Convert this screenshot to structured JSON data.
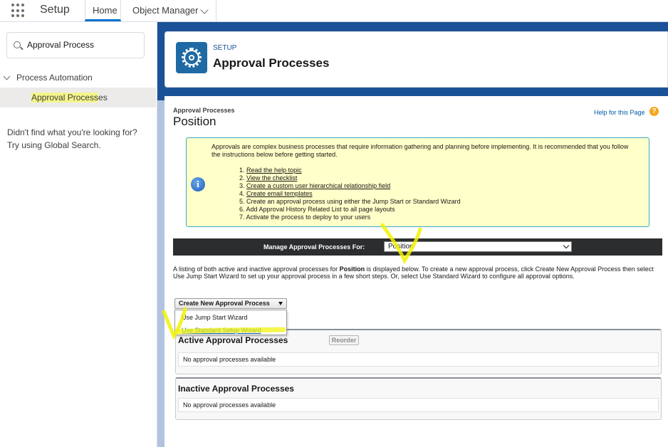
{
  "topbar": {
    "app_name": "Setup",
    "tabs": [
      {
        "label": "Home"
      },
      {
        "label": "Object Manager"
      }
    ]
  },
  "sidebar": {
    "search_value": "Approval Process",
    "tree": {
      "parent_label": "Process Automation",
      "child_label": "Approval Processes"
    },
    "hint_line1": "Didn't find what you're looking for?",
    "hint_line2": "Try using Global Search."
  },
  "header": {
    "eyebrow": "SETUP",
    "title": "Approval Processes"
  },
  "content": {
    "breadcrumb": "Approval Processes",
    "title": "Position",
    "help_link": "Help for this Page",
    "info": {
      "intro": "Approvals are complex business processes that require information gathering and planning before implementing. It is recommended that you follow the instructions below before getting started.",
      "steps": [
        {
          "num": "1.",
          "text": "Read the help topic",
          "link": true
        },
        {
          "num": "2.",
          "text": "View the checklist",
          "link": true
        },
        {
          "num": "3.",
          "text": "Create a custom user hierarchical relationship field",
          "link": true
        },
        {
          "num": "4.",
          "text": "Create email templates",
          "link": true
        },
        {
          "num": "5.",
          "text": "Create an approval process using either the Jump Start or Standard Wizard",
          "link": false
        },
        {
          "num": "6.",
          "text": "Add Approval History Related List to all page layouts",
          "link": false
        },
        {
          "num": "7.",
          "text": "Activate the process to deploy to your users",
          "link": false
        }
      ]
    },
    "manage": {
      "label": "Manage Approval Processes For:",
      "selected": "Position"
    },
    "listing": {
      "before": "A listing of both active and inactive approval processes for ",
      "object": "Position",
      "after": " is displayed below. To create a new approval process, click Create New Approval Process then select Use Jump Start Wizard to set up your approval process in a few short steps. Or, select Use Standard Wizard to configure all approval options."
    },
    "create_button": "Create New Approval Process",
    "menu": {
      "jump_start": "Use Jump Start Wizard",
      "standard": "Use Standard Setup Wizard"
    },
    "active_panel": {
      "title": "Active Approval Processes",
      "reorder": "Reorder",
      "empty": "No approval processes available"
    },
    "inactive_panel": {
      "title": "Inactive Approval Processes",
      "empty": "No approval processes available"
    }
  },
  "colors": {
    "brand_blue": "#1b5297",
    "link_blue": "#015ba7",
    "highlight": "#f2f200"
  }
}
